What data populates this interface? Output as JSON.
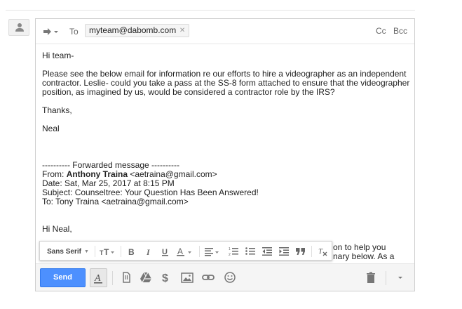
{
  "compose": {
    "to_label": "To",
    "recipient": "myteam@dabomb.com",
    "cc_label": "Cc",
    "bcc_label": "Bcc"
  },
  "body": {
    "greeting": "Hi team-",
    "para_line1": "Please see the below email for information re our efforts to hire a videographer as an independent",
    "para_line2": "contractor. Leslie- could you take a pass at the SS-8 form attached to ensure that the videographer",
    "para_line3": "position, as imagined by us, would be considered a contractor role by the IRS?",
    "thanks": "Thanks,",
    "signature": "Neal",
    "forward_header": "---------- Forwarded message ----------",
    "from_label": "From:",
    "from_name": "Anthony Traina",
    "from_email": "<aetraina@gmail.com>",
    "date_line": "Date: Sat, Mar 25, 2017 at 8:15 PM",
    "subject_line": "Subject: Counseltree: Your Question Has Been Answered!",
    "to_line": "To: Tony Traina <aetraina@gmail.com>",
    "reply_greeting": "Hi Neal,",
    "partial_line1": "on to help you",
    "partial_line2": "nary below. As a"
  },
  "format_toolbar": {
    "font_family": "Sans Serif"
  },
  "bottom_bar": {
    "send_label": "Send"
  },
  "colors": {
    "send_button": "#4d90fe",
    "chip_background": "#f5f5f5",
    "bar_background": "#f5f5f5"
  },
  "icons": [
    "person-icon",
    "reply-arrow-icon",
    "text-size-icon",
    "bold-icon",
    "italic-icon",
    "underline-icon",
    "text-color-icon",
    "align-icon",
    "numbered-list-icon",
    "bulleted-list-icon",
    "indent-less-icon",
    "indent-more-icon",
    "quote-icon",
    "remove-formatting-icon",
    "formatting-options-icon",
    "attach-file-icon",
    "google-drive-icon",
    "dollar-icon",
    "insert-photo-icon",
    "insert-link-icon",
    "emoji-icon",
    "trash-icon",
    "more-options-icon"
  ]
}
